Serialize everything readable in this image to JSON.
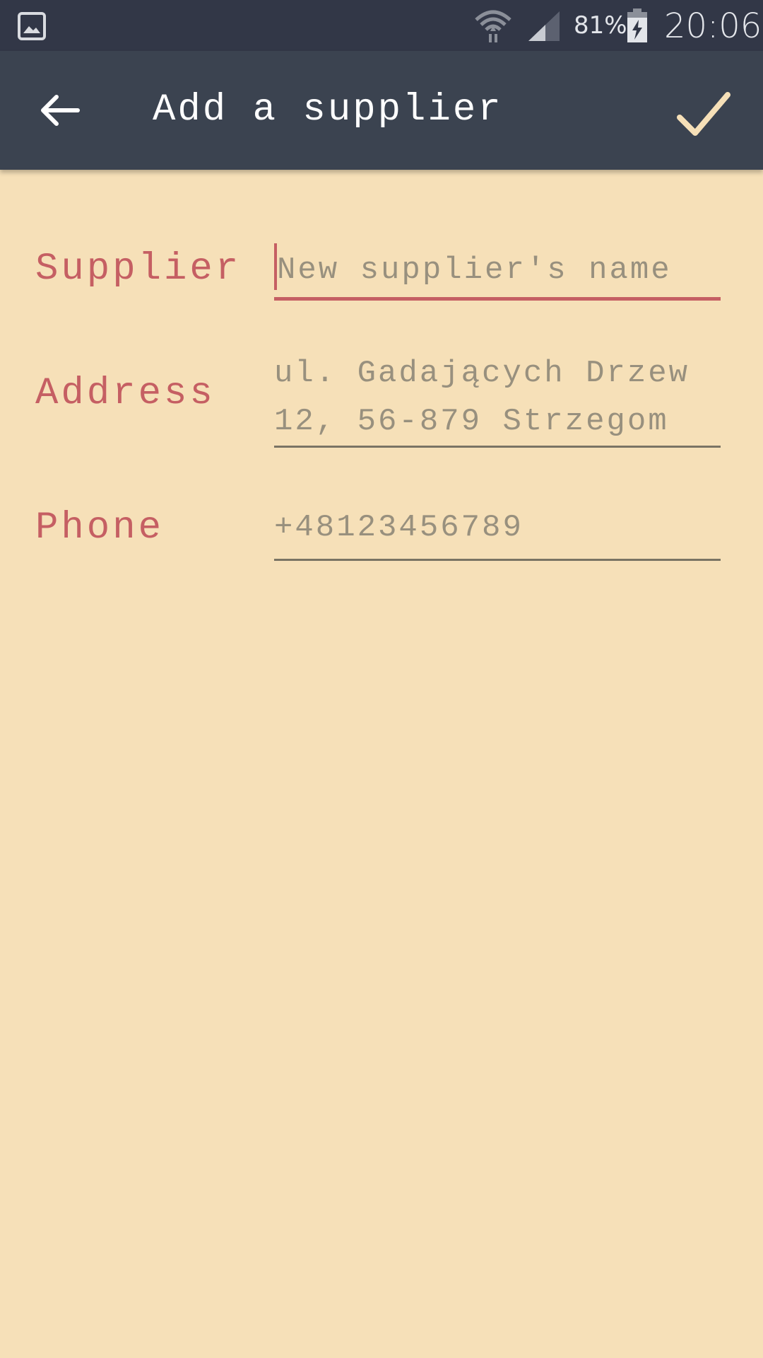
{
  "status_bar": {
    "battery_percent": "81%",
    "time": "20:06",
    "icons": [
      "gallery-icon",
      "wifi-icon",
      "signal-icon",
      "battery-charging-icon"
    ]
  },
  "toolbar": {
    "title": "Add a supplier",
    "back_icon": "arrow-left-icon",
    "confirm_icon": "checkmark-icon"
  },
  "form": {
    "supplier": {
      "label": "Supplier",
      "placeholder": "New supplier's name",
      "value": ""
    },
    "address": {
      "label": "Address",
      "placeholder": "ul. Gadających Drzew\n12, 56-879 Strzegom",
      "value": ""
    },
    "phone": {
      "label": "Phone",
      "placeholder": "+48123456789",
      "value": ""
    }
  },
  "colors": {
    "background": "#f6e0b8",
    "toolbar": "#3b4350",
    "status_bar": "#323747",
    "accent": "#c55f63",
    "confirm": "#f6e0b8"
  }
}
